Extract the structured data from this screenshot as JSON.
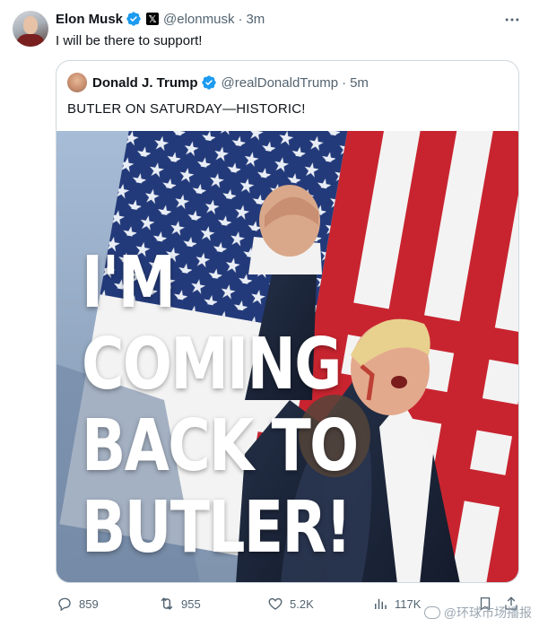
{
  "tweet": {
    "author_name": "Elon Musk",
    "author_handle": "@elonmusk",
    "separator": "·",
    "time": "3m",
    "text": "I will be there to support!",
    "verified_icon": "verified-badge-icon",
    "affiliate_badge": "𝕏"
  },
  "quoted": {
    "author_name": "Donald J. Trump",
    "author_handle": "@realDonaldTrump",
    "separator": "·",
    "time": "5m",
    "text": "BUTLER ON SATURDAY—HISTORIC!",
    "image_headline": [
      "I'M",
      "COMING",
      "BACK TO",
      "BUTLER!"
    ]
  },
  "actions": {
    "replies": "859",
    "reposts": "955",
    "likes": "5.2K",
    "views": "117K"
  },
  "watermark": "@环球市场播报",
  "colors": {
    "accent": "#1d9bf0",
    "secondary_text": "#536471",
    "border": "#cfd9de"
  }
}
